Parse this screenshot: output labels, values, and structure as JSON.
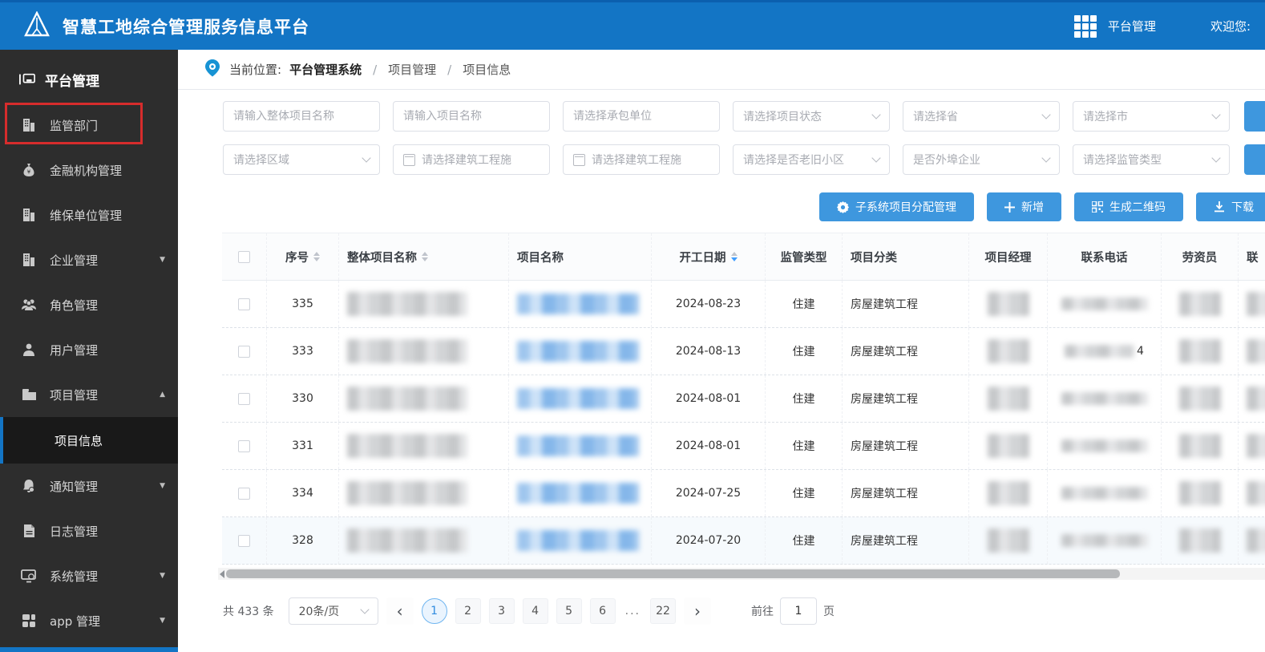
{
  "colors": {
    "header_blue": "#1375c5",
    "sidebar_bg": "#2d2d2d",
    "accent_button_blue": "#3e97de",
    "active_page_blue": "#2f8be0",
    "annotation_red": "#d62c2c",
    "link_blur_blue": "#9fc6ee"
  },
  "header": {
    "title": "智慧工地综合管理服务信息平台",
    "nav_platform": "平台管理",
    "welcome": "欢迎您:"
  },
  "sidebar": {
    "section_title": "平台管理",
    "items": [
      {
        "label": "监管部门",
        "icon": "building-icon",
        "arrow": ""
      },
      {
        "label": "金融机构管理",
        "icon": "moneybag-icon",
        "arrow": ""
      },
      {
        "label": "维保单位管理",
        "icon": "building-icon",
        "arrow": ""
      },
      {
        "label": "企业管理",
        "icon": "building-icon",
        "arrow": "▼"
      },
      {
        "label": "角色管理",
        "icon": "users-icon",
        "arrow": ""
      },
      {
        "label": "用户管理",
        "icon": "user-icon",
        "arrow": ""
      },
      {
        "label": "项目管理",
        "icon": "folder-icon",
        "arrow": "▲"
      },
      {
        "label": "通知管理",
        "icon": "bell-icon",
        "arrow": "▼"
      },
      {
        "label": "日志管理",
        "icon": "log-icon",
        "arrow": ""
      },
      {
        "label": "系统管理",
        "icon": "monitor-icon",
        "arrow": "▼"
      },
      {
        "label": "app 管理",
        "icon": "app-grid-icon",
        "arrow": "▼"
      }
    ],
    "submenu_active": "项目信息"
  },
  "breadcrumb": {
    "prefix": "当前位置:",
    "root": "平台管理系统",
    "items": [
      "项目管理",
      "项目信息"
    ]
  },
  "filters": {
    "row1": [
      {
        "type": "input",
        "placeholder": "请输入整体项目名称"
      },
      {
        "type": "input",
        "placeholder": "请输入项目名称"
      },
      {
        "type": "input",
        "placeholder": "请选择承包单位"
      },
      {
        "type": "select",
        "placeholder": "请选择项目状态"
      },
      {
        "type": "select",
        "placeholder": "请选择省"
      },
      {
        "type": "select",
        "placeholder": "请选择市"
      }
    ],
    "row2": [
      {
        "type": "select",
        "placeholder": "请选择区域"
      },
      {
        "type": "date",
        "placeholder": "请选择建筑工程施"
      },
      {
        "type": "date",
        "placeholder": "请选择建筑工程施"
      },
      {
        "type": "select",
        "placeholder": "请选择是否老旧小区"
      },
      {
        "type": "select",
        "placeholder": "是否外埠企业"
      },
      {
        "type": "select",
        "placeholder": "请选择监管类型"
      }
    ]
  },
  "actions": [
    {
      "label": "子系统项目分配管理",
      "icon": "gear-icon"
    },
    {
      "label": "新增",
      "icon": "plus-icon"
    },
    {
      "label": "生成二维码",
      "icon": "qrcode-icon"
    },
    {
      "label": "下载",
      "icon": "download-icon"
    }
  ],
  "table": {
    "columns": {
      "seq": "序号",
      "overall_name": "整体项目名称",
      "project_name": "项目名称",
      "start_date": "开工日期",
      "supervision": "监管类型",
      "category": "项目分类",
      "manager": "项目经理",
      "phone": "联系电话",
      "laborer": "劳资员",
      "clipped_last": "联"
    },
    "rows": [
      {
        "seq": "335",
        "start_date": "2024-08-23",
        "supervision": "住建",
        "category": "房屋建筑工程",
        "redacted": true,
        "phone_visible": ""
      },
      {
        "seq": "333",
        "start_date": "2024-08-13",
        "supervision": "住建",
        "category": "房屋建筑工程",
        "redacted": true,
        "phone_visible": "4"
      },
      {
        "seq": "330",
        "start_date": "2024-08-01",
        "supervision": "住建",
        "category": "房屋建筑工程",
        "redacted": true,
        "phone_visible": ""
      },
      {
        "seq": "331",
        "start_date": "2024-08-01",
        "supervision": "住建",
        "category": "房屋建筑工程",
        "redacted": true,
        "phone_visible": ""
      },
      {
        "seq": "334",
        "start_date": "2024-07-25",
        "supervision": "住建",
        "category": "房屋建筑工程",
        "redacted": true,
        "phone_visible": ""
      },
      {
        "seq": "328",
        "start_date": "2024-07-20",
        "supervision": "住建",
        "category": "房屋建筑工程",
        "redacted": true,
        "phone_visible": ""
      }
    ]
  },
  "pagination": {
    "total": "共 433 条",
    "page_size": "20条/页",
    "prev": "‹",
    "next": "›",
    "pages": [
      "1",
      "2",
      "3",
      "4",
      "5",
      "6",
      "...",
      "22"
    ],
    "active_page": "1",
    "goto_label": "前往",
    "goto_value": "1",
    "goto_suffix": "页"
  }
}
